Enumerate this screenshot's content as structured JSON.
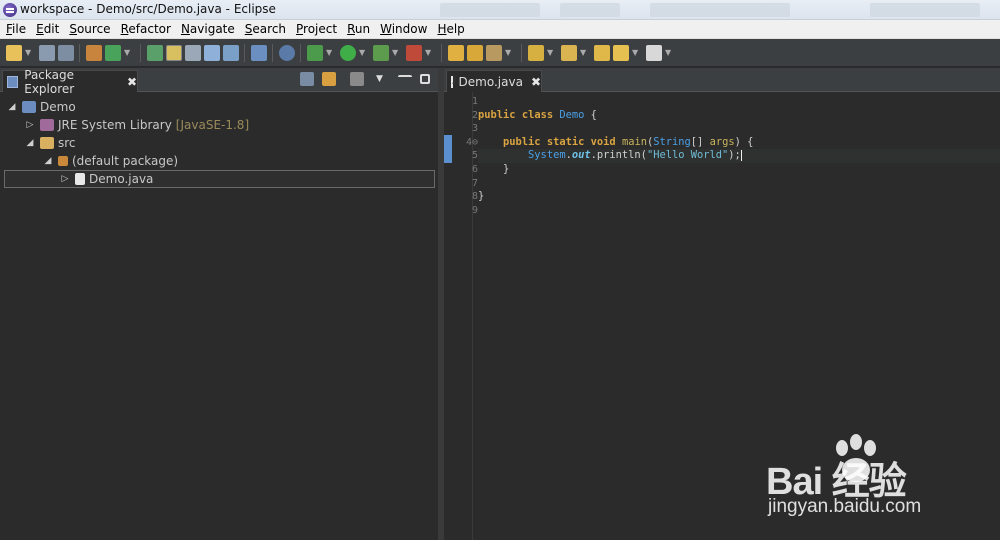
{
  "window": {
    "title": "workspace - Demo/src/Demo.java - Eclipse"
  },
  "menu": [
    "File",
    "Edit",
    "Source",
    "Refactor",
    "Navigate",
    "Search",
    "Project",
    "Run",
    "Window",
    "Help"
  ],
  "package_explorer": {
    "tab_label": "Package Explorer",
    "close_glyph": "✖",
    "tree": [
      {
        "label": "Demo",
        "extra": "",
        "arrow": "◢",
        "icon": "project-icon"
      },
      {
        "label": "JRE System Library",
        "extra": "[JavaSE-1.8]",
        "arrow": "▷",
        "icon": "library-icon"
      },
      {
        "label": "src",
        "extra": "",
        "arrow": "◢",
        "icon": "folder-icon"
      },
      {
        "label": "(default package)",
        "extra": "",
        "arrow": "◢",
        "icon": "package-icon"
      },
      {
        "label": "Demo.java",
        "extra": "",
        "arrow": "▷",
        "icon": "java-file-icon"
      }
    ]
  },
  "editor": {
    "tab_label": "Demo.java",
    "close_glyph": "✖",
    "line_numbers": [
      "1",
      "2",
      "3",
      "4⊖",
      "5",
      "6",
      "7",
      "8",
      "9"
    ]
  },
  "code": {
    "l2_kw1": "public",
    "l2_kw2": "class",
    "l2_name": "Demo",
    "l2_brace": " {",
    "l4_kw1": "public",
    "l4_kw2": "static",
    "l4_kw3": "void",
    "l4_name": "main",
    "l4_type": "String",
    "l4_rest1": "(",
    "l4_rest2": "[] ",
    "l4_arg": "args",
    "l4_rest3": ") {",
    "l5_type": "System",
    "l5_dot": ".",
    "l5_field": "out",
    "l5_call": ".println(",
    "l5_str": "\"Hello World\"",
    "l5_end": ");",
    "l6_close": "}",
    "l8_close": "}"
  },
  "watermark": {
    "main": "Bai  经验",
    "sub": "jingyan.baidu.com"
  },
  "colors": {
    "keyword": "#d9a441",
    "type": "#4aa0e6",
    "string": "#6fbcd6",
    "background": "#2b2b2b"
  }
}
